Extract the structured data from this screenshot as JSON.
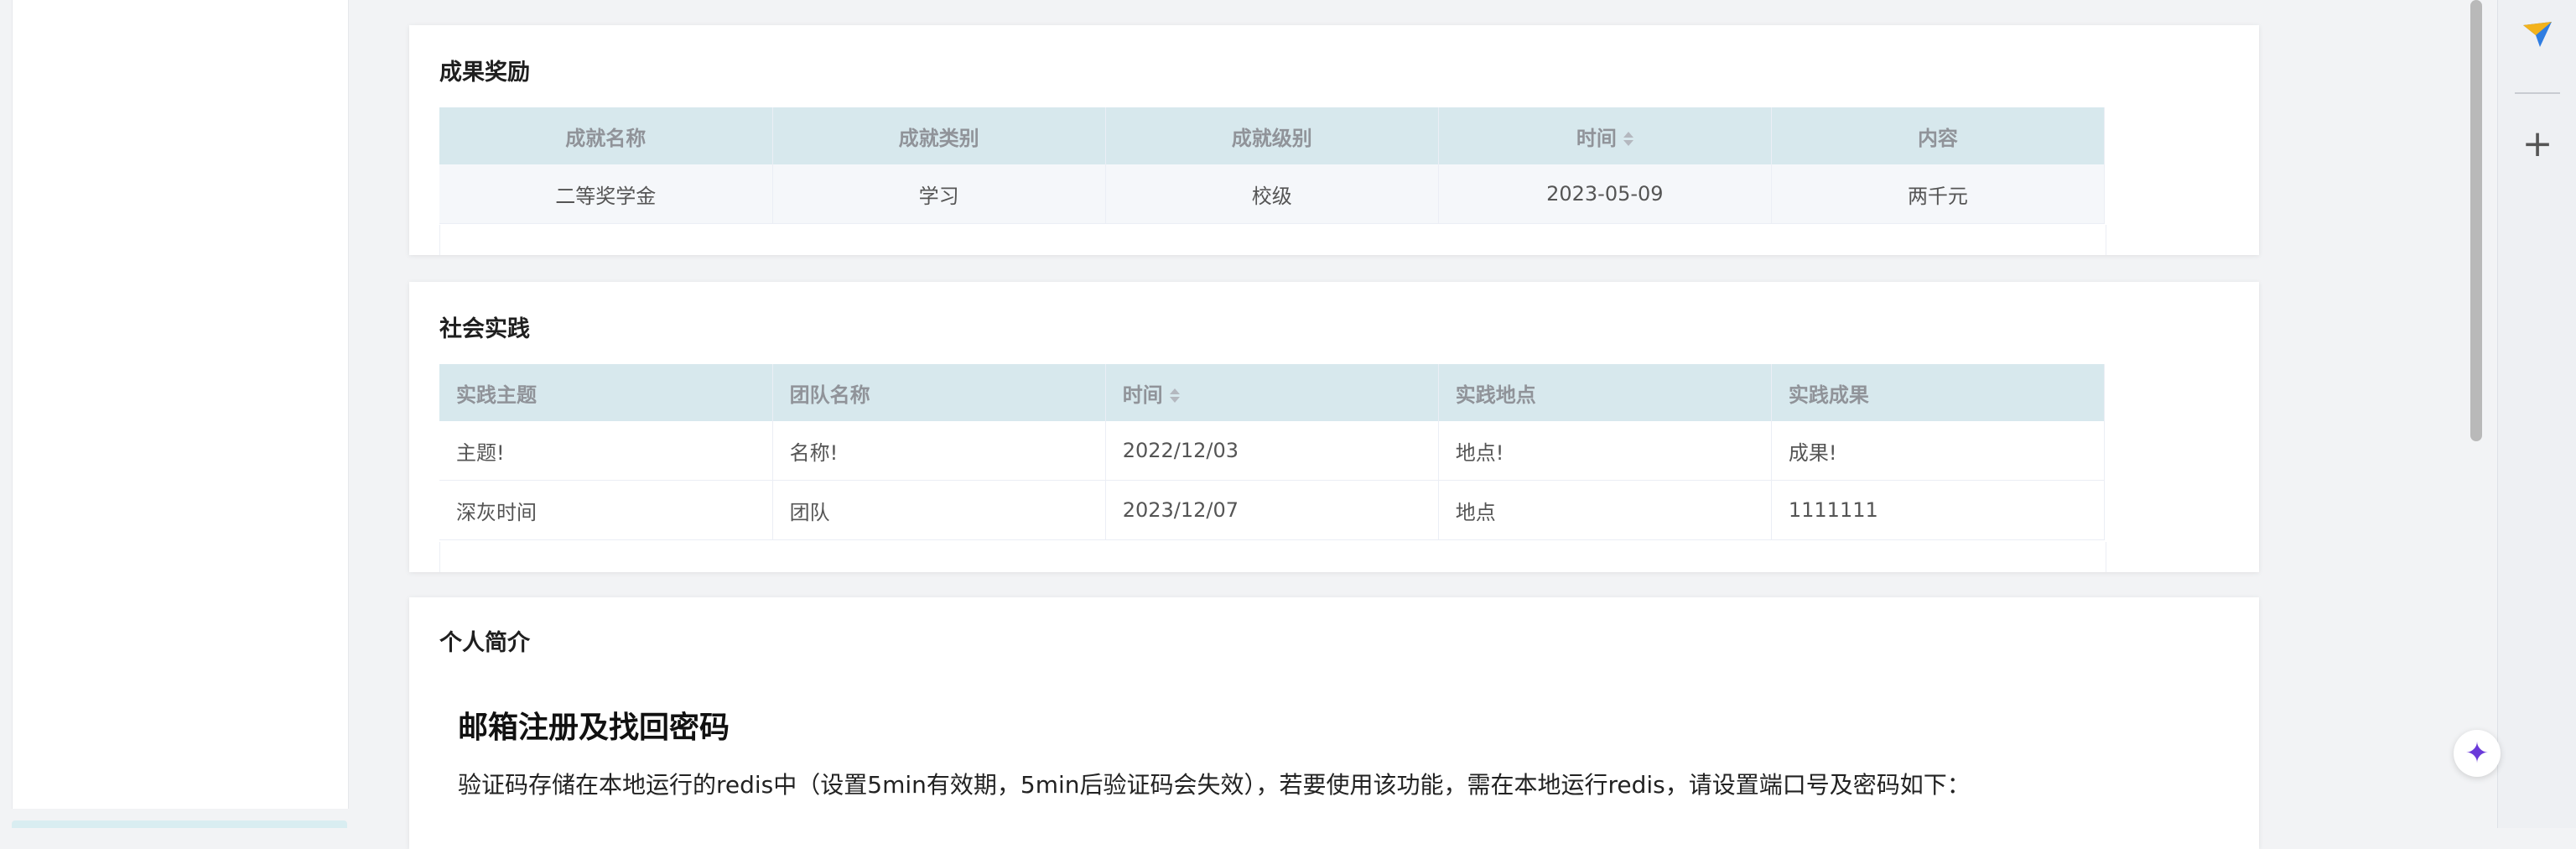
{
  "awards": {
    "title": "成果奖励",
    "columns": [
      "成就名称",
      "成就类别",
      "成就级别",
      "时间",
      "内容"
    ],
    "rows": [
      [
        "二等奖学金",
        "学习",
        "校级",
        "2023-05-09",
        "两千元"
      ]
    ]
  },
  "practice": {
    "title": "社会实践",
    "columns": [
      "实践主题",
      "团队名称",
      "时间",
      "实践地点",
      "实践成果"
    ],
    "rows": [
      [
        "主题!",
        "名称!",
        "2022/12/03",
        "地点!",
        "成果!"
      ],
      [
        "深灰时间",
        "团队",
        "2023/12/07",
        "地点",
        "1111111"
      ]
    ]
  },
  "intro": {
    "title": "个人简介",
    "heading": "邮箱注册及找回密码",
    "paragraph": "验证码存储在本地运行的redis中（设置5min有效期，5min后验证码会失效），若要使用该功能，需在本地运行redis，请设置端口号及密码如下："
  },
  "sidebar_right": {
    "icons": [
      "send-icon",
      "plus-icon"
    ],
    "plus_glyph": "+",
    "sparkle_glyph": "✦"
  },
  "colors": {
    "table_header_bg": "#d7e8ed",
    "accent_purple": "#6a3ad9"
  }
}
